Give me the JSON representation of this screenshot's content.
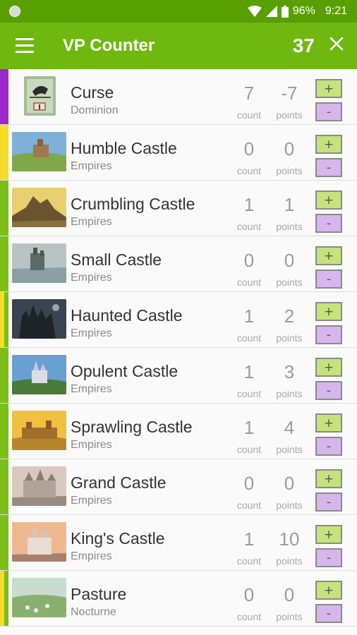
{
  "status": {
    "battery": "96%",
    "time": "9:21"
  },
  "toolbar": {
    "title": "VP Counter",
    "total": "37"
  },
  "labels": {
    "count": "count",
    "points": "points",
    "plus": "+",
    "minus": "-"
  },
  "colors": {
    "primary_dark": "#58a000",
    "primary": "#6eb810",
    "plus_button": "#c6e27a",
    "minus_button": "#d6b6ec",
    "stripe_purple": "#9b28c8",
    "stripe_yellow": "#f7dc2a",
    "stripe_green": "#7cbf19"
  },
  "cards": [
    {
      "name": "Curse",
      "set": "Dominion",
      "count": "7",
      "points": "-7"
    },
    {
      "name": "Humble Castle",
      "set": "Empires",
      "count": "0",
      "points": "0"
    },
    {
      "name": "Crumbling Castle",
      "set": "Empires",
      "count": "1",
      "points": "1"
    },
    {
      "name": "Small Castle",
      "set": "Empires",
      "count": "0",
      "points": "0"
    },
    {
      "name": "Haunted Castle",
      "set": "Empires",
      "count": "1",
      "points": "2"
    },
    {
      "name": "Opulent Castle",
      "set": "Empires",
      "count": "1",
      "points": "3"
    },
    {
      "name": "Sprawling Castle",
      "set": "Empires",
      "count": "1",
      "points": "4"
    },
    {
      "name": "Grand Castle",
      "set": "Empires",
      "count": "0",
      "points": "0"
    },
    {
      "name": "King's Castle",
      "set": "Empires",
      "count": "1",
      "points": "10"
    },
    {
      "name": "Pasture",
      "set": "Nocturne",
      "count": "0",
      "points": "0"
    }
  ]
}
